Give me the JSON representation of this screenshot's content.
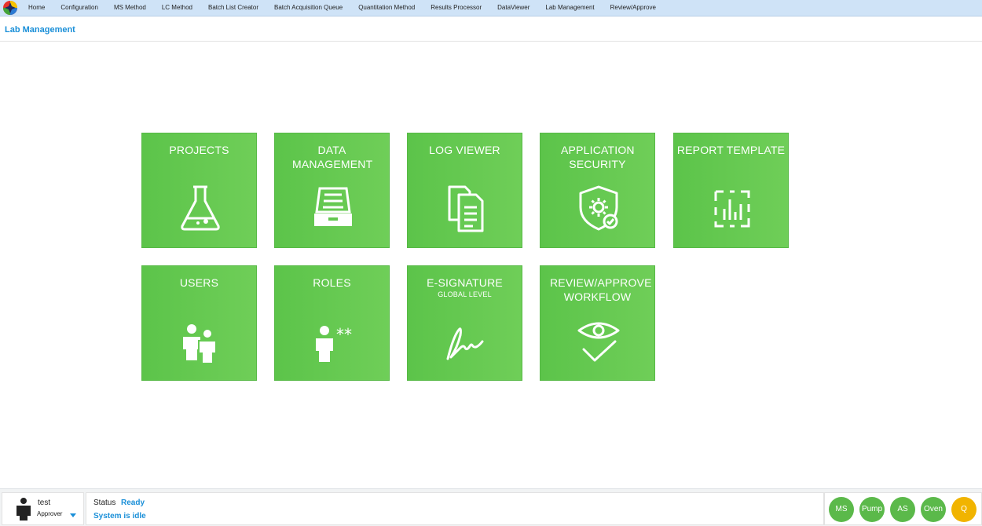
{
  "menu": {
    "items": [
      "Home",
      "Configuration",
      "MS Method",
      "LC Method",
      "Batch List Creator",
      "Batch Acquisition Queue",
      "Quantitation Method",
      "Results Processor",
      "DataViewer",
      "Lab Management",
      "Review/Approve"
    ]
  },
  "page": {
    "title": "Lab Management"
  },
  "tiles": [
    {
      "label": "PROJECTS",
      "sub": "",
      "icon": "flask-icon"
    },
    {
      "label": "DATA MANAGEMENT",
      "sub": "",
      "icon": "archive-drawer-icon"
    },
    {
      "label": "LOG VIEWER",
      "sub": "",
      "icon": "documents-icon"
    },
    {
      "label": "APPLICATION SECURITY",
      "sub": "",
      "icon": "shield-gear-icon"
    },
    {
      "label": "REPORT TEMPLATE",
      "sub": "",
      "icon": "report-chart-icon"
    },
    {
      "label": "USERS",
      "sub": "",
      "icon": "users-icon"
    },
    {
      "label": "ROLES",
      "sub": "",
      "icon": "user-role-icon"
    },
    {
      "label": "E-SIGNATURE",
      "sub": "GLOBAL LEVEL",
      "icon": "signature-icon"
    },
    {
      "label": "REVIEW/APPROVE WORKFLOW",
      "sub": "",
      "icon": "eye-check-icon"
    }
  ],
  "user": {
    "name": "test",
    "role": "Approver"
  },
  "status": {
    "label": "Status",
    "value": "Ready",
    "message": "System is idle"
  },
  "devices": [
    {
      "label": "MS",
      "state": "ok"
    },
    {
      "label": "Pump",
      "state": "ok"
    },
    {
      "label": "AS",
      "state": "ok"
    },
    {
      "label": "Oven",
      "state": "ok"
    },
    {
      "label": "Q",
      "state": "warn"
    }
  ],
  "colors": {
    "tile": "#5cc44a",
    "accent": "#1a8fd8",
    "menubar": "#cfe3f7",
    "warn": "#f1b400"
  }
}
